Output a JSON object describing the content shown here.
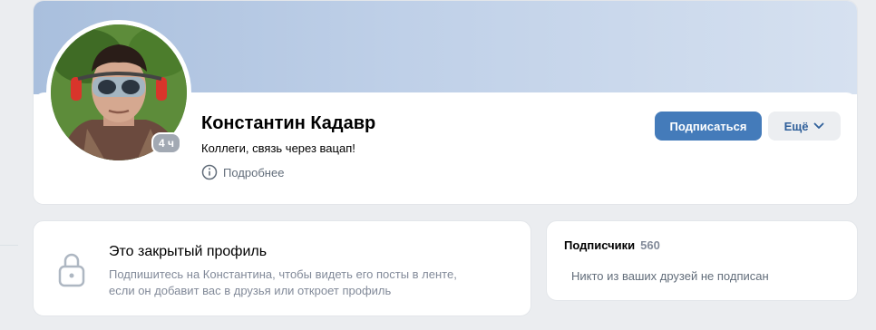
{
  "profile": {
    "name": "Константин Кадавр",
    "status": "Коллеги, связь через вацап!",
    "more_info_label": "Подробнее",
    "online_badge": "4 ч"
  },
  "actions": {
    "subscribe_label": "Подписаться",
    "more_label": "Ещё"
  },
  "private_profile": {
    "title": "Это закрытый профиль",
    "line1": "Подпишитесь на Константина, чтобы видеть его посты в ленте,",
    "line2": "если он добавит вас в друзья или откроет профиль"
  },
  "followers": {
    "title": "Подписчики",
    "count": "560",
    "empty_text": "Никто из ваших друзей не подписан"
  },
  "colors": {
    "accent": "#447bba",
    "secondary_button_bg": "#eceef1",
    "page_bg": "#ebedf0"
  },
  "icons": {
    "info": "info-circle-icon",
    "chevron": "chevron-down-icon",
    "lock": "lock-icon"
  }
}
